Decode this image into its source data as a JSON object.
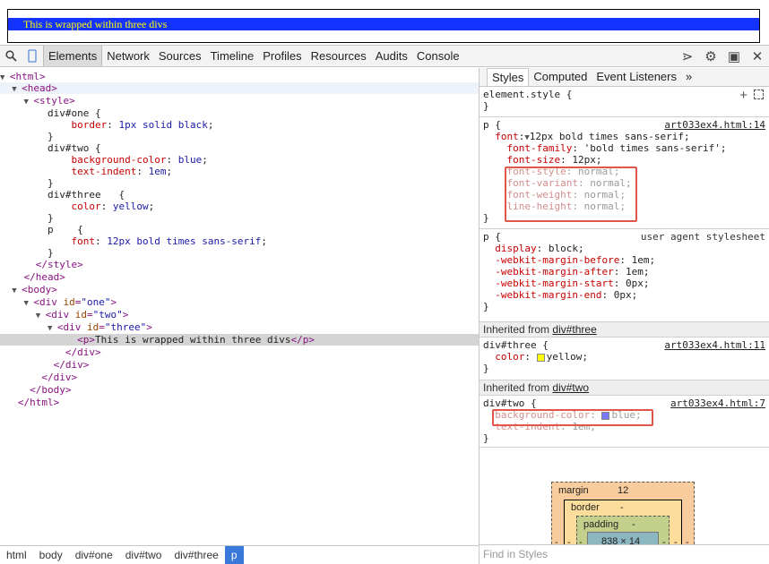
{
  "preview": {
    "text": "This is wrapped within three divs"
  },
  "toolbar": {
    "tabs": [
      "Elements",
      "Network",
      "Sources",
      "Timeline",
      "Profiles",
      "Resources",
      "Audits",
      "Console"
    ],
    "right_icons": [
      "console-drawer-icon",
      "gear-icon",
      "dock-icon",
      "close-icon"
    ]
  },
  "dom": {
    "html_open": "<html>",
    "head_open": "<head>",
    "style_open": "<style>",
    "css1_sel": "div#one {",
    "css1_prop": "border",
    "css1_val": "1px solid black",
    "close_brace": "}",
    "css2_sel": "div#two {",
    "css2_prop1": "background-color",
    "css2_val1": "blue",
    "css2_prop2": "text-indent",
    "css2_val2": "1em",
    "css3_sel": "div#three   {",
    "css3_prop": "color",
    "css3_val": "yellow",
    "css4_sel": "p    {",
    "css4_prop": "font",
    "css4_val": "12px bold times sans-serif",
    "style_close": "</style>",
    "head_close": "</head>",
    "body_open": "<body>",
    "div_one": "one",
    "div_two": "two",
    "div_three": "three",
    "p_text": "This is wrapped within three divs",
    "div_close": "</div>",
    "body_close": "</body>",
    "html_close": "</html>"
  },
  "breadcrumbs": [
    "html",
    "body",
    "div#one",
    "div#two",
    "div#three",
    "p"
  ],
  "styles": {
    "sub_tabs": [
      "Styles",
      "Computed",
      "Event Listeners",
      "»"
    ],
    "element_style": "element.style {",
    "rule_p": {
      "selector": "p {",
      "source": "art033ex4.html:14",
      "font": "12px bold times sans-serif;",
      "font_family": "'bold times sans-serif';",
      "font_size": "12px;",
      "font_style": "normal;",
      "font_variant": "normal;",
      "font_weight": "normal;",
      "line_height": "normal;"
    },
    "rule_ua": {
      "selector": "p {",
      "source": "user agent stylesheet",
      "display": "block;",
      "mb": "1em;",
      "ma": "1em;",
      "ms": "0px;",
      "me": "0px;"
    },
    "inherited_three_label": "Inherited from",
    "inherited_three_link": "div#three",
    "rule_three": {
      "selector": "div#three {",
      "source": "art033ex4.html:11",
      "color": "yellow;"
    },
    "inherited_two_label": "Inherited from",
    "inherited_two_link": "div#two",
    "rule_two": {
      "selector": "div#two {",
      "source": "art033ex4.html:7",
      "bg": "blue;",
      "indent": "1em;"
    },
    "box_model": {
      "margin": "margin",
      "margin_val": "12",
      "border": "border",
      "border_val": "-",
      "padding": "padding",
      "padding_val": "-",
      "content": "838 × 14",
      "dash": "-"
    },
    "find_placeholder": "Find in Styles"
  },
  "colors": {
    "swatch_yellow": "#ffff00",
    "swatch_blue": "#7a7aff",
    "highlight": "#e0564a"
  }
}
